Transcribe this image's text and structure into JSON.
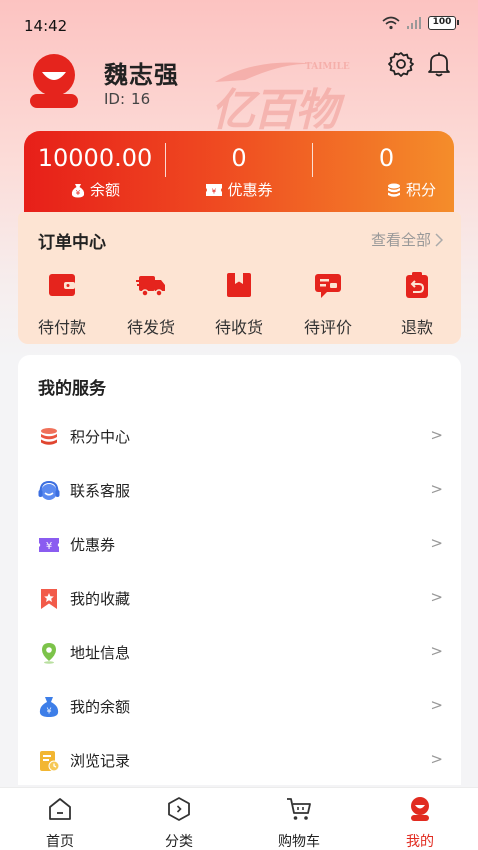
{
  "status_bar": {
    "time": "14:42",
    "battery": "100"
  },
  "profile": {
    "name": "魏志强",
    "id_label": "ID:",
    "id_value": "16",
    "watermark_text": "亿百物"
  },
  "wallet": {
    "balance_value": "10000.00",
    "balance_label": "余额",
    "coupon_value": "0",
    "coupon_label": "优惠券",
    "points_value": "0",
    "points_label": "积分"
  },
  "orders": {
    "title": "订单中心",
    "view_all": "查看全部",
    "items": [
      {
        "label": "待付款",
        "icon": "wallet-icon"
      },
      {
        "label": "待发货",
        "icon": "truck-icon"
      },
      {
        "label": "待收货",
        "icon": "package-icon"
      },
      {
        "label": "待评价",
        "icon": "review-icon"
      },
      {
        "label": "退款",
        "icon": "refund-icon"
      }
    ]
  },
  "services": {
    "title": "我的服务",
    "items": [
      {
        "label": "积分中心",
        "icon": "coins-icon",
        "arrow": ">"
      },
      {
        "label": "联系客服",
        "icon": "headset-icon",
        "arrow": ">"
      },
      {
        "label": "优惠券",
        "icon": "coupon-icon",
        "arrow": ">"
      },
      {
        "label": "我的收藏",
        "icon": "bookmark-icon",
        "arrow": ">"
      },
      {
        "label": "地址信息",
        "icon": "location-pin-icon",
        "arrow": ">"
      },
      {
        "label": "我的余额",
        "icon": "money-bag-icon",
        "arrow": ">"
      },
      {
        "label": "浏览记录",
        "icon": "history-icon",
        "arrow": ">"
      }
    ]
  },
  "tabbar": {
    "items": [
      {
        "label": "首页",
        "icon": "home-icon",
        "active": false
      },
      {
        "label": "分类",
        "icon": "category-icon",
        "active": false
      },
      {
        "label": "购物车",
        "icon": "cart-icon",
        "active": false
      },
      {
        "label": "我的",
        "icon": "profile-icon",
        "active": true
      }
    ]
  },
  "colors": {
    "accent": "#e12b20",
    "wallet_gradient_start": "#e71f19",
    "wallet_gradient_end": "#f48d2a",
    "order_panel_bg": "#fde4d3"
  }
}
